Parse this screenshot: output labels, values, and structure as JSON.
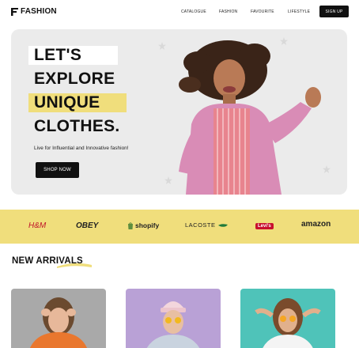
{
  "brand": {
    "name": "FASHION"
  },
  "nav": {
    "items": [
      "CATALOGUE",
      "FASHION",
      "FAVOURITE",
      "LIFESTYLE"
    ],
    "signup_label": "SIGN UP"
  },
  "hero": {
    "headline": [
      "LET'S",
      "EXPLORE",
      "UNIQUE",
      "CLOTHES."
    ],
    "tagline": "Live for Influential and Innovative fashion!",
    "cta_label": "SHOP NOW",
    "background": "#ebebeb",
    "highlight_color": "#f0de7c"
  },
  "brands": {
    "background": "#f0de7c",
    "items": [
      "H&M",
      "OBEY",
      "shopify",
      "LACOSTE",
      "Levi's",
      "amazon"
    ]
  },
  "arrivals": {
    "title": "NEW ARRIVALS",
    "cards": [
      {
        "name": "product-orange-hoodie",
        "bg": "#a9a9a9"
      },
      {
        "name": "product-beanie-sunglasses",
        "bg": "#b9a1d6"
      },
      {
        "name": "product-teal-tshirt",
        "bg": "#4fc3b9"
      }
    ]
  }
}
